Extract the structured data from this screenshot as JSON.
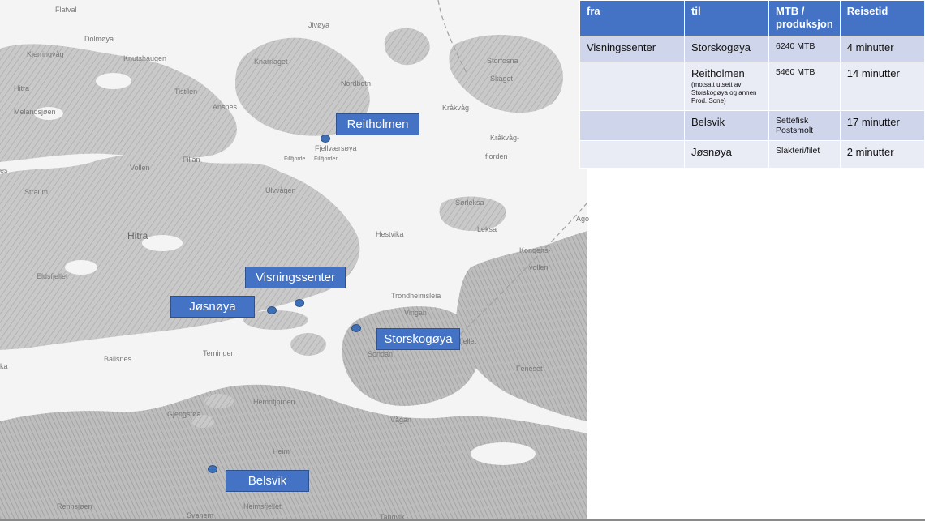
{
  "map": {
    "place_labels": [
      {
        "text": "Flatval",
        "size": "normal"
      },
      {
        "text": "Jlvøya",
        "size": "normal"
      },
      {
        "text": "Dolmøya",
        "size": "normal"
      },
      {
        "text": "Kjerringvåg",
        "size": "normal"
      },
      {
        "text": "Knutshaugen",
        "size": "normal"
      },
      {
        "text": "Knarrlaget",
        "size": "normal"
      },
      {
        "text": "Storfosna",
        "size": "normal"
      },
      {
        "text": "Skaget",
        "size": "normal"
      },
      {
        "text": "Hitra",
        "size": "normal"
      },
      {
        "text": "Tistilen",
        "size": "normal"
      },
      {
        "text": "Nordbotn",
        "size": "normal"
      },
      {
        "text": "Melandsjøen",
        "size": "normal"
      },
      {
        "text": "Ansnes",
        "size": "normal"
      },
      {
        "text": "Kråkvåg",
        "size": "normal"
      },
      {
        "text": "Kråkvåg-",
        "size": "normal"
      },
      {
        "text": "fjorden",
        "size": "normal"
      },
      {
        "text": "Fjellværsøya",
        "size": "normal"
      },
      {
        "text": "Fillfjorde",
        "size": "small"
      },
      {
        "text": "Fillfjorden",
        "size": "small"
      },
      {
        "text": "Fillan",
        "size": "normal"
      },
      {
        "text": "Vollen",
        "size": "normal"
      },
      {
        "text": "Straum",
        "size": "normal"
      },
      {
        "text": "Ulvvågen",
        "size": "normal"
      },
      {
        "text": "Sørleksa",
        "size": "normal"
      },
      {
        "text": "Leksa",
        "size": "normal"
      },
      {
        "text": "Hitra",
        "size": "big"
      },
      {
        "text": "Hestvika",
        "size": "normal"
      },
      {
        "text": "Kongens-",
        "size": "normal"
      },
      {
        "text": "vollen",
        "size": "normal"
      },
      {
        "text": "Eldsfjellet",
        "size": "normal"
      },
      {
        "text": "Trondheimsleia",
        "size": "normal"
      },
      {
        "text": "Vingan",
        "size": "normal"
      },
      {
        "text": "fjellet",
        "size": "normal"
      },
      {
        "text": "Ballsnes",
        "size": "normal"
      },
      {
        "text": "Terningen",
        "size": "normal"
      },
      {
        "text": "Sondan",
        "size": "normal"
      },
      {
        "text": "Feneset",
        "size": "normal"
      },
      {
        "text": "Hemnfjorden",
        "size": "normal"
      },
      {
        "text": "Gjengstøa",
        "size": "normal"
      },
      {
        "text": "Vågan",
        "size": "normal"
      },
      {
        "text": "Heim",
        "size": "normal"
      },
      {
        "text": "Rennsjøen",
        "size": "normal"
      },
      {
        "text": "Heimsfjellet",
        "size": "normal"
      },
      {
        "text": "Svanem",
        "size": "normal"
      },
      {
        "text": "Tangvik",
        "size": "normal"
      },
      {
        "text": "Ago",
        "size": "normal"
      },
      {
        "text": "ka",
        "size": "normal"
      },
      {
        "text": "es",
        "size": "normal"
      }
    ],
    "locations": [
      {
        "label": "Reitholmen"
      },
      {
        "label": "Visningssenter"
      },
      {
        "label": "Jøsnøya"
      },
      {
        "label": "Storskogøya"
      },
      {
        "label": "Belsvik"
      }
    ],
    "marker_color": "#3f6fb5",
    "callout_color": "#4472c4"
  },
  "table": {
    "headers": [
      "fra",
      "til",
      "MTB / produksjon",
      "Reisetid"
    ],
    "rows": [
      {
        "fra": "Visningssenter",
        "til": "Storskogøya",
        "note": "",
        "mtb": "6240 MTB",
        "reisetid": "4 minutter"
      },
      {
        "fra": "",
        "til": "Reitholmen",
        "note": "(motsatt utsett av Storskogøya og annen Prod. Sone)",
        "mtb": "5460 MTB",
        "reisetid": "14 minutter"
      },
      {
        "fra": "",
        "til": "Belsvik",
        "note": "",
        "mtb": "Settefisk Postsmolt",
        "reisetid": "17 minutter"
      },
      {
        "fra": "",
        "til": "Jøsnøya",
        "note": "",
        "mtb": "Slakteri/filet",
        "reisetid": "2 minutter"
      }
    ],
    "header_color": "#4472c4",
    "row_colors": [
      "#cfd5ea",
      "#e9ebf5"
    ]
  }
}
